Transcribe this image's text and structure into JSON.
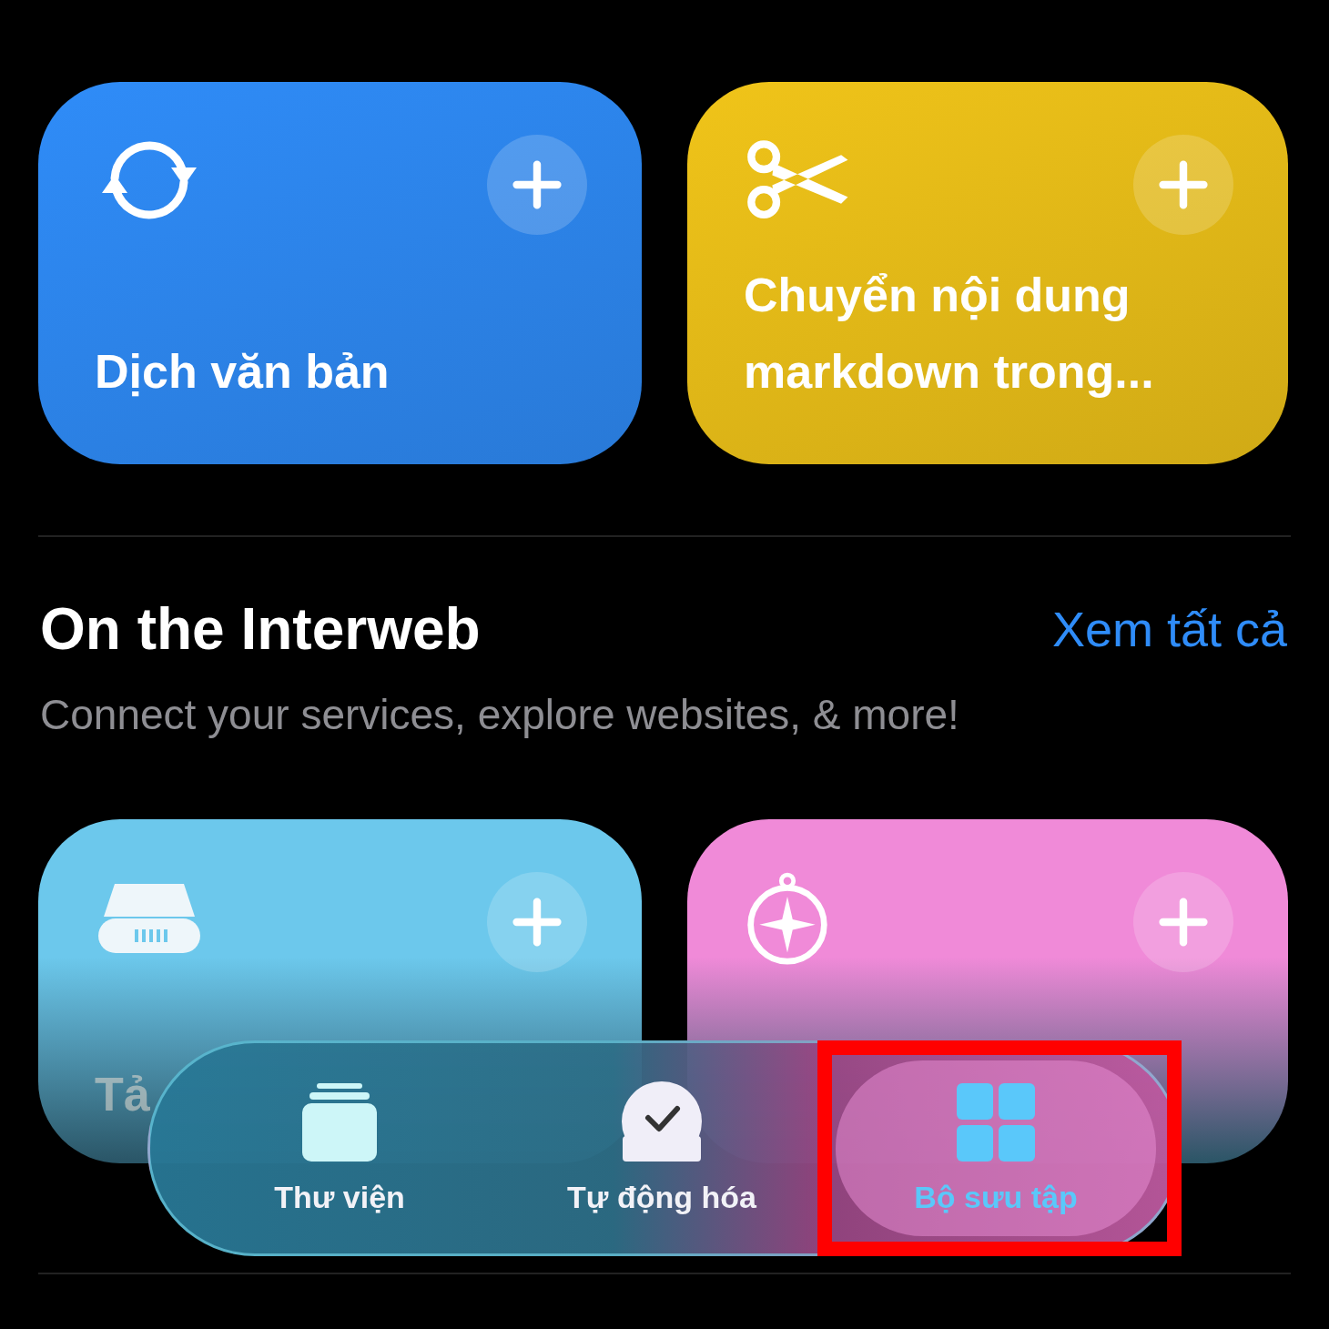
{
  "top_cards": [
    {
      "kind": "sync",
      "color": "#2f8cf8",
      "title": "Dịch văn bản"
    },
    {
      "kind": "scissors",
      "color": "#f0c419",
      "title": "Chuyển nội dung markdown trong..."
    }
  ],
  "section": {
    "title": "On the Interweb",
    "link": "Xem tất cả",
    "subtitle": "Connect your services, explore websites, & more!"
  },
  "bottom_cards": [
    {
      "kind": "drive",
      "color": "#6cc8ec",
      "title": "Tả"
    },
    {
      "kind": "compass",
      "color": "#f08ad8"
    }
  ],
  "tab_bar": {
    "tabs": [
      {
        "kind": "library",
        "label": "Thư viện",
        "selected": false,
        "highlighted": false
      },
      {
        "kind": "automation",
        "label": "Tự động hóa",
        "selected": false,
        "highlighted": false
      },
      {
        "kind": "gallery",
        "label": "Bộ sưu tập",
        "selected": true,
        "highlighted": true
      }
    ]
  }
}
